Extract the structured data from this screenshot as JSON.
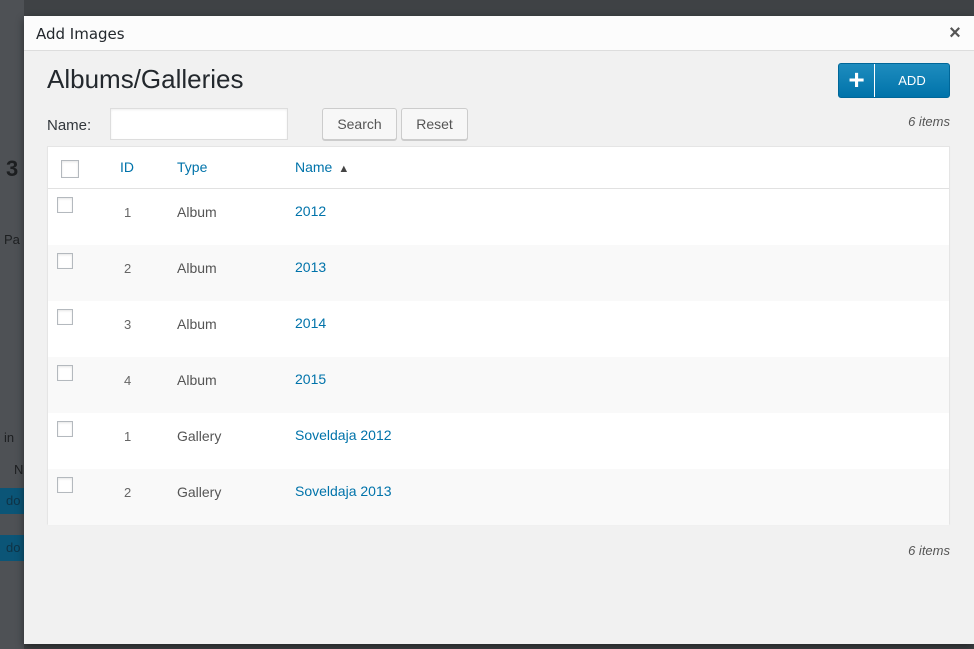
{
  "background_fragments": {
    "digit": "3",
    "partial_word": "Pa",
    "partial_word_2": "in",
    "letter": "N",
    "button_fragment_1": "do",
    "button_fragment_2": "do"
  },
  "modal": {
    "title": "Add Images",
    "close_symbol": "×",
    "heading": "Albums/Galleries",
    "add_button": {
      "icon_symbol": "+",
      "label": "ADD",
      "color": "#0073aa"
    },
    "search": {
      "label": "Name:",
      "value": "",
      "placeholder": "",
      "search_label": "Search",
      "reset_label": "Reset"
    },
    "items_count_top": "6 items",
    "items_count_bottom": "6 items",
    "table": {
      "columns": {
        "id": "ID",
        "type": "Type",
        "name": "Name",
        "sort_indicator": "▲"
      },
      "rows": [
        {
          "id": "1",
          "type": "Album",
          "name": "2012"
        },
        {
          "id": "2",
          "type": "Album",
          "name": "2013"
        },
        {
          "id": "3",
          "type": "Album",
          "name": "2014"
        },
        {
          "id": "4",
          "type": "Album",
          "name": "2015"
        },
        {
          "id": "1",
          "type": "Gallery",
          "name": "Soveldaja 2012"
        },
        {
          "id": "2",
          "type": "Gallery",
          "name": "Soveldaja 2013"
        }
      ]
    },
    "link_color": "#0073aa"
  }
}
